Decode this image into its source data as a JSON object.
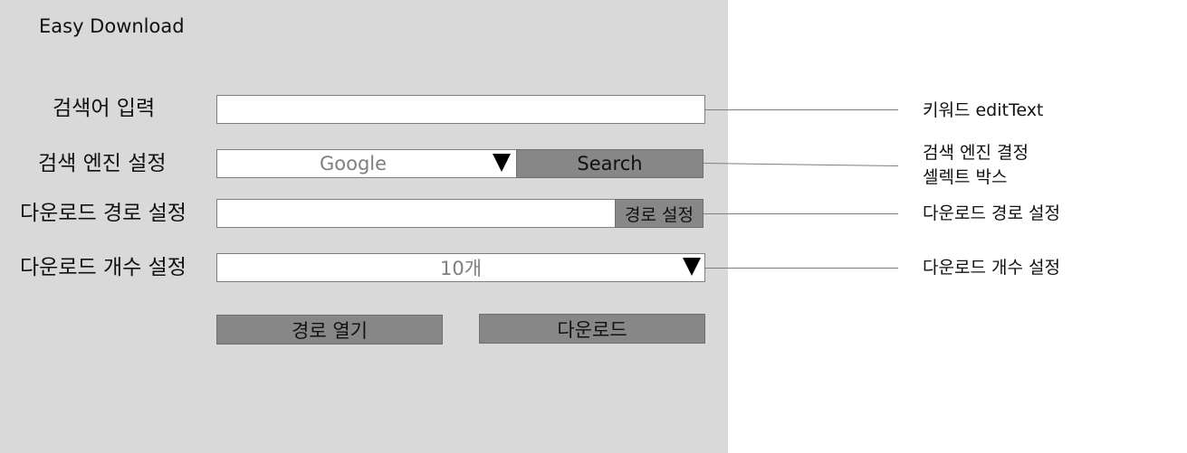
{
  "app": {
    "title": "Easy Download"
  },
  "form": {
    "keyword_label": "검색어 입력",
    "keyword_value": "",
    "engine_label": "검색 엔진 설정",
    "engine_selected": "Google",
    "search_button": "Search",
    "path_label": "다운로드 경로 설정",
    "path_value": "",
    "path_button": "경로 설정",
    "count_label": "다운로드 개수 설정",
    "count_selected": "10개",
    "open_path_button": "경로 열기",
    "download_button": "다운로드"
  },
  "annotations": {
    "keyword": "키워드 editText",
    "engine_line1": "검색 엔진 결정",
    "engine_line2": "셀렉트 박스",
    "path": "다운로드 경로 설정",
    "count": "다운로드 개수 설정"
  },
  "icons": {
    "dropdown_arrow": "triangle-down"
  },
  "colors": {
    "panel_background": "#d9d9d9",
    "button_gray": "#878787",
    "page_background": "#ffffff"
  }
}
